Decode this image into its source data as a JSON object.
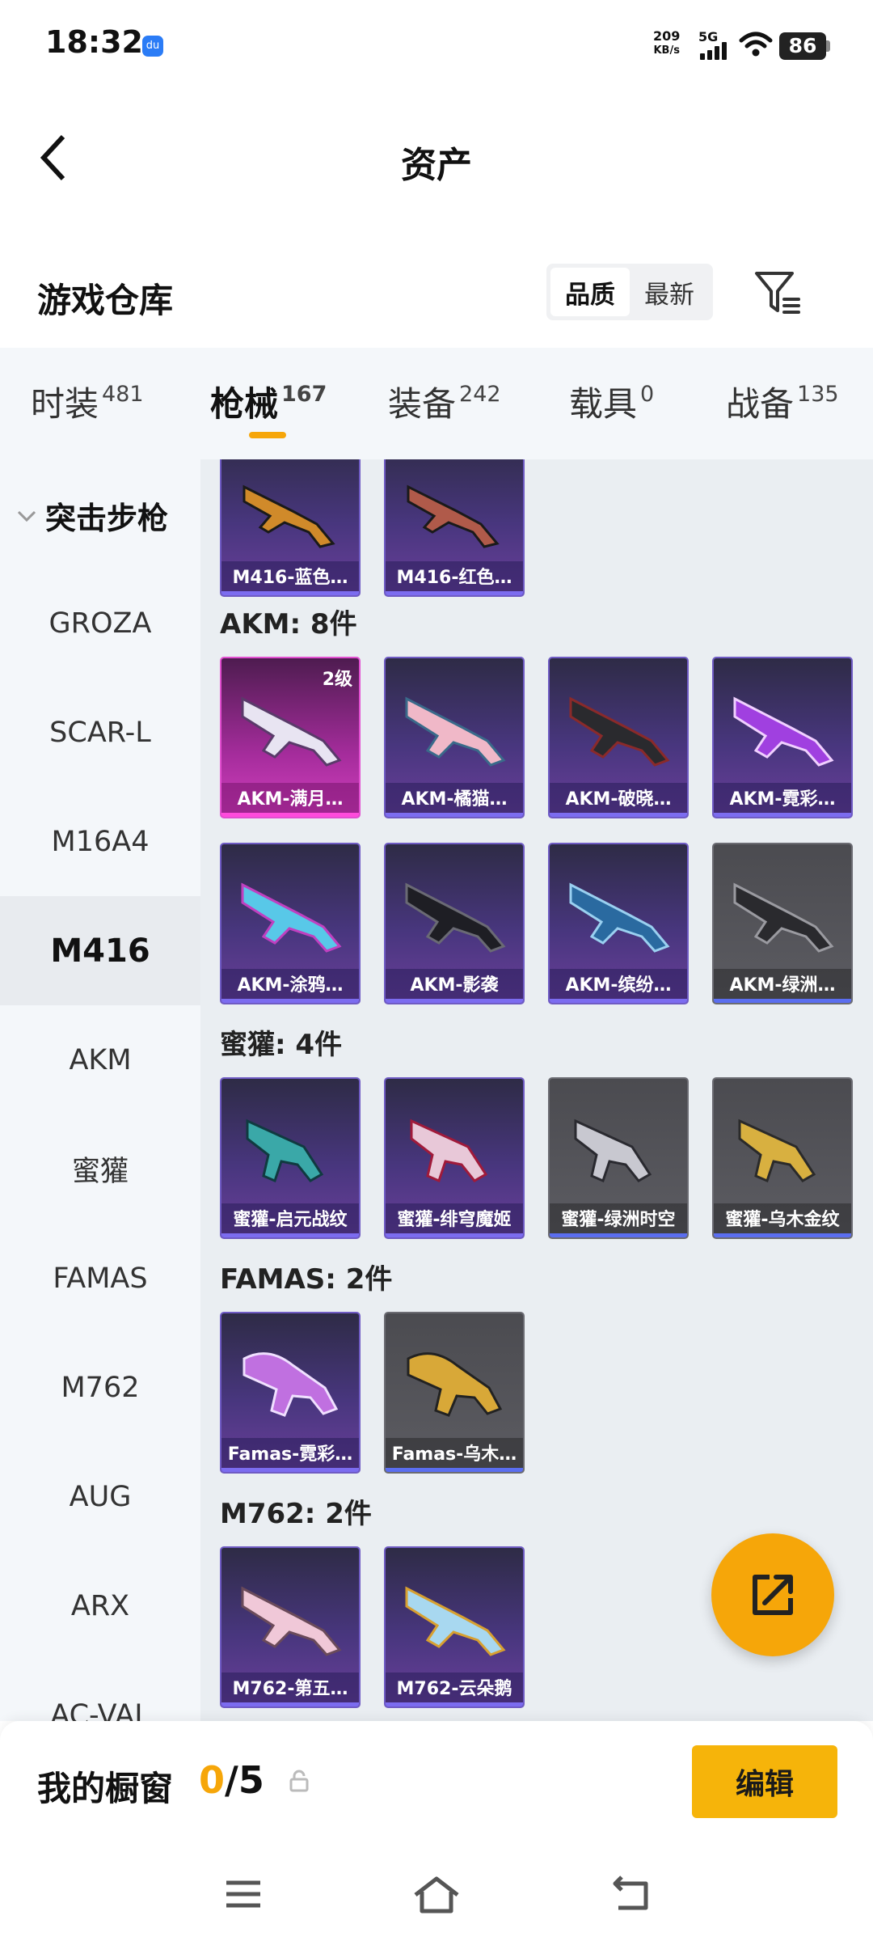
{
  "status_bar": {
    "time": "18:32",
    "app_icon_text": "du",
    "net_speed": "209",
    "net_unit": "KB/s",
    "network": "5G",
    "battery": "86"
  },
  "header": {
    "title": "资产"
  },
  "warehouse": {
    "title": "游戏仓库",
    "sort_options": [
      "品质",
      "最新"
    ],
    "active_sort": "品质"
  },
  "tabs": [
    {
      "label": "时装",
      "count": "481"
    },
    {
      "label": "枪械",
      "count": "167",
      "active": true
    },
    {
      "label": "装备",
      "count": "242"
    },
    {
      "label": "载具",
      "count": "0"
    },
    {
      "label": "战备",
      "count": "135"
    }
  ],
  "sidebar": {
    "group": "突击步枪",
    "items": [
      "GROZA",
      "SCAR-L",
      "M16A4",
      "M416",
      "AKM",
      "蜜獾",
      "FAMAS",
      "M762",
      "AUG",
      "ARX",
      "AC-VAL"
    ],
    "active": "M416"
  },
  "sections": [
    {
      "title": "",
      "items": [
        {
          "name": "M416-蓝色…",
          "tier": "purple"
        },
        {
          "name": "M416-红色…",
          "tier": "purple"
        }
      ]
    },
    {
      "title": "AKM: 8件",
      "items": [
        {
          "name": "AKM-满月…",
          "tier": "gold",
          "badge": "2级"
        },
        {
          "name": "AKM-橘猫…",
          "tier": "purple"
        },
        {
          "name": "AKM-破晓…",
          "tier": "purple"
        },
        {
          "name": "AKM-霓彩…",
          "tier": "purple"
        },
        {
          "name": "AKM-涂鸦…",
          "tier": "purple"
        },
        {
          "name": "AKM-影袭",
          "tier": "purple"
        },
        {
          "name": "AKM-缤纷…",
          "tier": "purple"
        },
        {
          "name": "AKM-绿洲…",
          "tier": "grey"
        }
      ]
    },
    {
      "title": "蜜獾: 4件",
      "items": [
        {
          "name": "蜜獾-启元战纹",
          "tier": "purple"
        },
        {
          "name": "蜜獾-绯穹魔姬",
          "tier": "purple"
        },
        {
          "name": "蜜獾-绿洲时空",
          "tier": "grey"
        },
        {
          "name": "蜜獾-乌木金纹",
          "tier": "grey"
        }
      ]
    },
    {
      "title": "FAMAS: 2件",
      "items": [
        {
          "name": "Famas-霓彩…",
          "tier": "purple"
        },
        {
          "name": "Famas-乌木…",
          "tier": "grey"
        }
      ]
    },
    {
      "title": "M762: 2件",
      "items": [
        {
          "name": "M762-第五…",
          "tier": "purple"
        },
        {
          "name": "M762-云朵鹅",
          "tier": "purple"
        }
      ]
    }
  ],
  "showcase": {
    "title": "我的橱窗",
    "current": "0",
    "total": "/5",
    "edit_label": "编辑"
  },
  "colors": {
    "accent": "#f6a609",
    "tab_bg": "#f4f7fa",
    "content_bg": "#eaeef2"
  }
}
